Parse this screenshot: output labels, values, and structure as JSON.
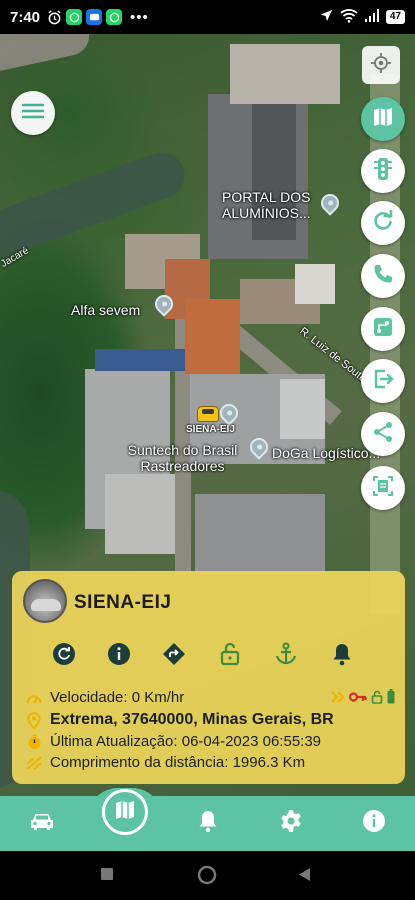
{
  "status_bar": {
    "time": "7:40",
    "icons": [
      "alarm-icon",
      "whatsapp-icon",
      "message-icon",
      "whatsapp-icon",
      "more-dots"
    ],
    "right_icons": [
      "location-arrow-icon",
      "wifi-icon",
      "signal-icon"
    ],
    "battery": "47"
  },
  "map": {
    "labels": {
      "portal": "PORTAL DOS ALUMÍNIOS...",
      "alfa": "Alfa sevem",
      "suntech": "Suntech do Brasil Rastreadores",
      "doga": "DoGa Logístico...",
      "street": "R. Luiz de Souto",
      "road_left": "Jacaré"
    },
    "vehicle_label": "SIENA-EIJ"
  },
  "fab_buttons": [
    "map-icon",
    "traffic-light-icon",
    "refresh-icon",
    "phone-icon",
    "route-icon",
    "exit-icon",
    "share-icon",
    "document-scan-icon"
  ],
  "card": {
    "vehicle_name": "SIENA-EIJ",
    "actions": [
      "refresh-icon",
      "info-icon",
      "directions-icon",
      "unlock-icon",
      "anchor-icon",
      "bell-icon"
    ],
    "speed": "Velocidade: 0 Km/hr",
    "address": "Extrema, 37640000, Minas Gerais, BR",
    "last_update": "Última Atualização: 06-04-2023 06:55:39",
    "distance": "Comprimento da distância: 1996.3 Km",
    "colors": {
      "card_bg": "#eed65a",
      "icon_dark": "#1d3d3a",
      "icon_green": "#3d8b3d",
      "key_red": "#d32f2f",
      "signal_yellow": "#f0b400"
    }
  },
  "bottom_nav": {
    "items": [
      "car-icon",
      "map-icon",
      "bell-icon",
      "gear-icon",
      "info-icon"
    ],
    "accent": "#5cc4a3"
  },
  "system_nav": [
    "recents-button",
    "home-button",
    "back-button"
  ]
}
